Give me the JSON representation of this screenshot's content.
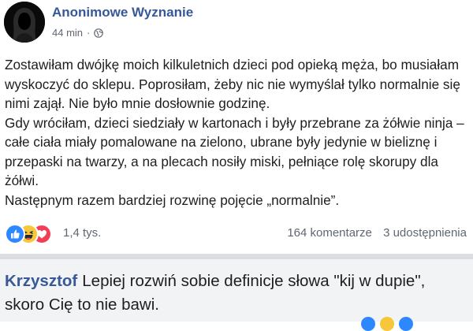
{
  "post": {
    "author": "Anonimowe Wyznanie",
    "time": "44 min",
    "separator": "·",
    "paragraphs": [
      "Zostawiłam dwójkę moich kilkuletnich dzieci pod opieką męża, bo musiałam wyskoczyć do sklepu. Poprosiłam, żeby nic nie wymyślał tylko normalnie się nimi zajął. Nie było mnie dosłownie godzinę.",
      "Gdy wróciłam, dzieci siedziały w kartonach i były przebrane za żółwie ninja – całe ciała miały pomalowane na zielono, ubrane były jedynie w bieliznę i przepaski na twarzy, a na plecach nosiły miski, pełniące rolę skorupy dla żółwi.",
      "Następnym razem bardziej rozwinę pojęcie „normalnie”."
    ],
    "reactions_count": "1,4 tys.",
    "comments": "164 komentarze",
    "shares": "3 udostępnienia",
    "reaction_icons": [
      "like-icon",
      "haha-icon",
      "love-icon"
    ]
  },
  "comment": {
    "author": "Krzysztof",
    "text": "Lepiej rozwiń sobie definicje słowa \"kij w dupie\", skoro Cię to nie bawi."
  },
  "colors": {
    "author_link": "#365899",
    "comment_author": "#385898",
    "like": "#2d88ff",
    "haha": "#f7c639",
    "love": "#f33e58",
    "comment_bg": "#f2f3f5"
  }
}
